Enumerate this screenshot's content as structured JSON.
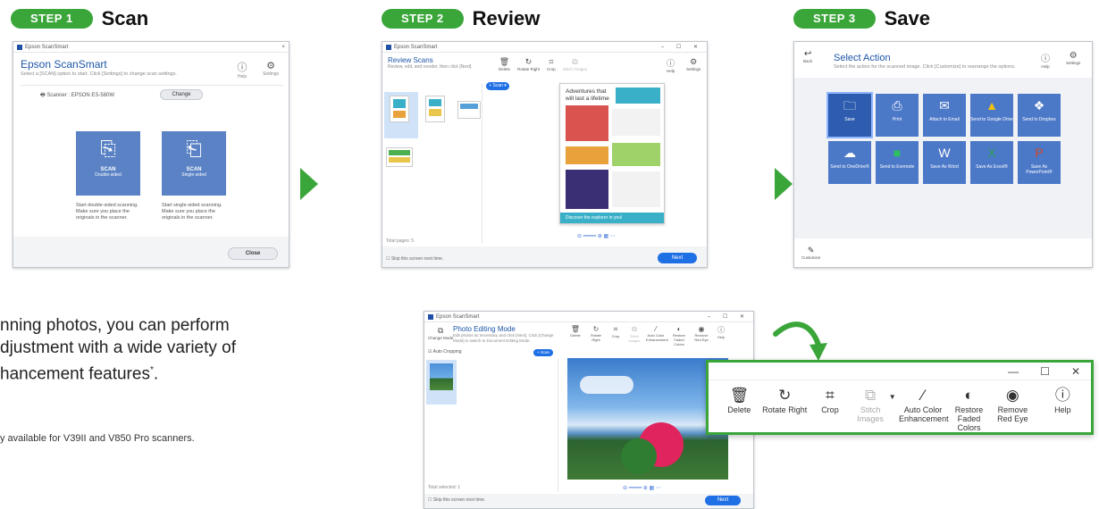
{
  "steps": [
    {
      "pill": "STEP 1",
      "title": "Scan"
    },
    {
      "pill": "STEP 2",
      "title": "Review"
    },
    {
      "pill": "STEP 3",
      "title": "Save"
    }
  ],
  "scan_window": {
    "titlebar": "Epson ScanSmart",
    "close_x": "×",
    "heading": "Epson ScanSmart",
    "subtitle": "Select a [SCAN] option to start. Click [Settings] to change scan settings.",
    "help": "Help",
    "settings": "Settings",
    "scanner_label": "Scanner : EPSON ES-580W",
    "change": "Change",
    "tile1_title": "SCAN",
    "tile1_sub": "Double-sided",
    "tile2_title": "SCAN",
    "tile2_sub": "Single-sided",
    "desc1": "Start double-sided scanning. Make sure you place the originals in the scanner.",
    "desc2": "Start single-sided scanning. Make sure you place the originals in the scanner.",
    "close": "Close"
  },
  "review_window": {
    "titlebar": "Epson ScanSmart",
    "heading": "Review Scans",
    "subtitle": "Review, edit, and reorder, then click [Next].",
    "toolbar": [
      "Delete",
      "Rotate Right",
      "Crop",
      "Stitch Images"
    ],
    "help": "Help",
    "settings": "Settings",
    "scan_btn": "+ Scan ▾",
    "doc_title": "Adventures that will last a lifetime",
    "doc_footer": "Discover the explorer in you!",
    "total": "Total pages: 5",
    "skip": "Skip this screen next time.",
    "next": "Next"
  },
  "save_window": {
    "back": "Back",
    "heading": "Select Action",
    "subtitle": "Select the action for the scanned image. Click [Customize] to rearrange the options.",
    "help": "Help",
    "settings": "Settings",
    "actions": [
      "Save",
      "Print",
      "Attach to Email",
      "Send to Google Drive",
      "Send to Dropbox",
      "Send to OneDrive®",
      "Send to Evernote",
      "Save As Word",
      "Save As Excel®",
      "Save As PowerPoint®"
    ],
    "customize": "Customize"
  },
  "photo_window": {
    "titlebar": "Epson ScanSmart",
    "change_mode": "Change Mode",
    "heading": "Photo Editing Mode",
    "subtitle": "Edit photos as necessary and click [Next]. Click [Change Mode] to switch to Document Editing Mode.",
    "toolbar": [
      "Delete",
      "Rotate Right",
      "Crop",
      "Stitch Images",
      "Auto Color Enhancement",
      "Restore Faded Colors",
      "Remove Red Eye",
      "Help"
    ],
    "auto_crop": "Auto Cropping",
    "scan_btn": "+ Scan",
    "total": "Total selected: 1",
    "skip": "Skip this screen next time.",
    "next": "Next"
  },
  "zoom_panel": {
    "minimize": "—",
    "maximize": "☐",
    "close": "✕",
    "tools": [
      "Delete",
      "Rotate Right",
      "Crop",
      "Stitch Images",
      "Auto Color Enhancement",
      "Restore Faded Colors",
      "Remove Red Eye",
      "Help"
    ]
  },
  "description": {
    "line1": "nning photos, you can perform",
    "line2": "djustment with a wide variety of",
    "line3": "hancement features",
    "asterisk": "*",
    "period": ".",
    "footnote": "y available for V39II and V850 Pro scanners."
  },
  "colors": {
    "accent_green": "#3aa63a",
    "epson_blue": "#1e56a8",
    "tile_blue": "#5a82c4",
    "action_blue": "#4c78c8"
  }
}
